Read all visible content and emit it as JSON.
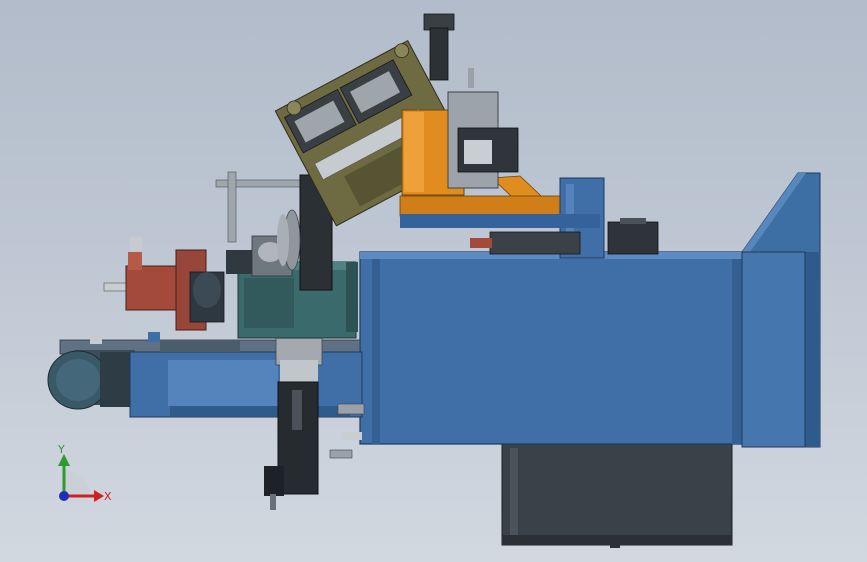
{
  "viewport": {
    "background_top": "#b2bcca",
    "background_bottom": "#d2d8e0"
  },
  "triad": {
    "y_label": "Y",
    "x_label": "X",
    "y_color": "#2f9a2f",
    "x_color": "#cc2222",
    "z_color": "#1d2fb8"
  },
  "palette": {
    "frame_blue": "#3f6fa6",
    "frame_blue_dark": "#2c5485",
    "teal_green": "#3a6a6c",
    "orange": "#e08c1e",
    "olive": "#6e6a42",
    "rust_red": "#a34a3a",
    "dark_gray": "#3b4147",
    "steel": "#9aa1a8"
  }
}
